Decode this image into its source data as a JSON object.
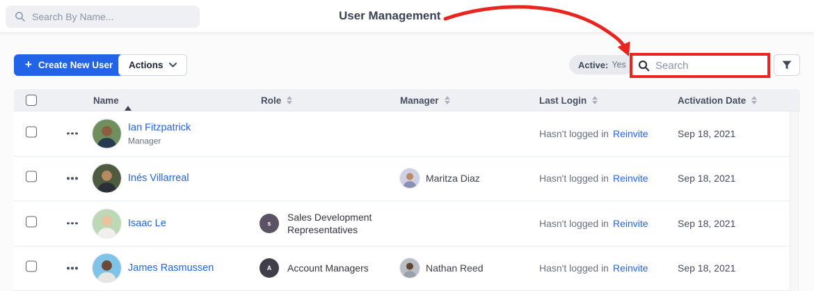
{
  "topbar": {
    "search_placeholder": "Search By Name..."
  },
  "annotation": {
    "label": "User Management",
    "color": "#e8251f"
  },
  "toolbar": {
    "create_label": "Create New User",
    "actions_label": "Actions",
    "active_label": "Active:",
    "active_value": "Yes",
    "search_placeholder": "Search"
  },
  "icons": [
    "search-icon",
    "plus-icon",
    "chevron-down-icon",
    "filter-funnel-icon",
    "more-dots-icon",
    "sort-asc-icon",
    "sort-both-icon"
  ],
  "colors": {
    "accent_blue": "#2264e5",
    "annotation_red": "#e8251f",
    "header_bg": "#eef0f4",
    "gray_text": "#687182",
    "dark_text": "#464f60"
  },
  "table": {
    "columns": [
      {
        "label": "Name",
        "sort": "asc"
      },
      {
        "label": "Role",
        "sort": "none"
      },
      {
        "label": "Manager",
        "sort": "none"
      },
      {
        "label": "Last Login",
        "sort": "none"
      },
      {
        "label": "Activation Date",
        "sort": "none"
      }
    ],
    "rows": [
      {
        "name": "Ian Fitzpatrick",
        "subtitle": "Manager",
        "last_login": "Hasn't logged in",
        "reinvite_label": "Reinvite",
        "activation_date": "Sep 18, 2021",
        "avatar": {
          "bg": "#6f8f5f",
          "skin": "#8d5d3f",
          "shirt": "#263a52"
        }
      },
      {
        "name": "Inés Villarreal",
        "manager": {
          "name": "Maritza Diaz",
          "avatar": {
            "bg": "#cfd0e4",
            "skin": "#b98a62",
            "shirt": "#8d8fb0"
          }
        },
        "last_login": "Hasn't logged in",
        "reinvite_label": "Reinvite",
        "activation_date": "Sep 18, 2021",
        "avatar": {
          "bg": "#4e5b3f",
          "skin": "#b98a62",
          "shirt": "#2b3038"
        }
      },
      {
        "name": "Isaac Le",
        "role": {
          "initial": "s",
          "label": "Sales Development Representatives",
          "badge_color": "#5b5263"
        },
        "last_login": "Hasn't logged in",
        "reinvite_label": "Reinvite",
        "activation_date": "Sep 18, 2021",
        "avatar": {
          "bg": "#bcd8b5",
          "skin": "#e8c39c",
          "shirt": "#efefed"
        }
      },
      {
        "name": "James Rasmussen",
        "role": {
          "initial": "A",
          "label": "Account Managers",
          "badge_color": "#413d4b"
        },
        "manager": {
          "name": "Nathan Reed",
          "avatar": {
            "bg": "#b9bdc4",
            "skin": "#5f4632",
            "shirt": "#9aa0a8"
          }
        },
        "last_login": "Hasn't logged in",
        "reinvite_label": "Reinvite",
        "activation_date": "Sep 18, 2021",
        "avatar": {
          "bg": "#7fc3e8",
          "skin": "#6b4a35",
          "shirt": "#e8e6e2"
        }
      }
    ]
  }
}
